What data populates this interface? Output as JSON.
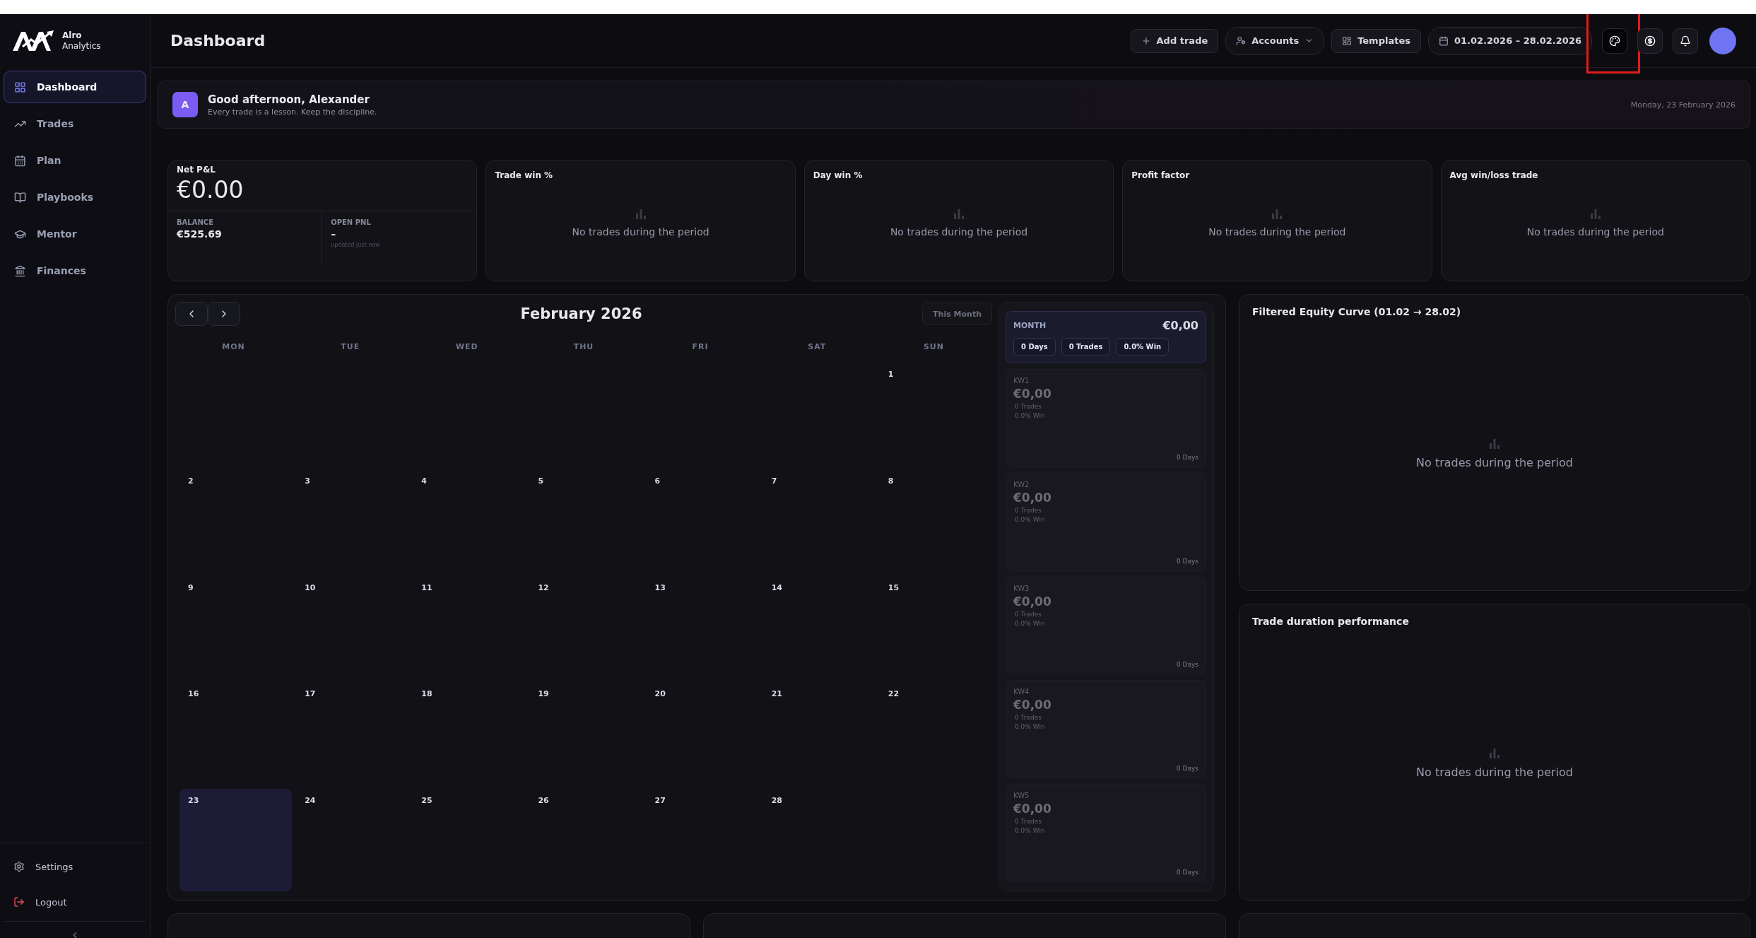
{
  "brand": {
    "name": "Alro",
    "subtitle": "Analytics"
  },
  "sidebar": {
    "items": [
      {
        "label": "Dashboard",
        "kind": "dashboard",
        "selected": true
      },
      {
        "label": "Trades",
        "kind": "trades",
        "selected": false
      },
      {
        "label": "Plan",
        "kind": "plan",
        "selected": false
      },
      {
        "label": "Playbooks",
        "kind": "playbooks",
        "selected": false
      },
      {
        "label": "Mentor",
        "kind": "mentor",
        "selected": false
      },
      {
        "label": "Finances",
        "kind": "finances",
        "selected": false
      }
    ],
    "footer_items": [
      {
        "label": "Settings",
        "kind": "settings"
      },
      {
        "label": "Logout",
        "kind": "logout"
      }
    ]
  },
  "header": {
    "title": "Dashboard",
    "buttons": [
      {
        "label": "Add trade",
        "kind": "add"
      },
      {
        "label": "Accounts",
        "kind": "accounts"
      },
      {
        "label": "Templates",
        "kind": "templates"
      },
      {
        "label": "01.02.2026 – 28.02.2026",
        "kind": "date"
      }
    ],
    "icon_buttons": [
      {
        "kind": "palette",
        "highlighted": true
      },
      {
        "kind": "dollar",
        "highlighted": false
      },
      {
        "kind": "bell",
        "highlighted": false
      }
    ]
  },
  "greeting": {
    "avatar": "A",
    "title": "Good afternoon, Alexander",
    "subtitle": "Every trade is a lesson. Keep the discipline.",
    "date": "Monday, 23 February 2026"
  },
  "kpis": [
    {
      "kind": "pnl",
      "title": "Net P&L",
      "value": "€0.00",
      "balance_label": "BALANCE",
      "balance": "€525.69",
      "open_label": "OPEN PNL",
      "open": "–",
      "updated": "updated just now"
    },
    {
      "kind": "empty",
      "title": "Trade win %",
      "message": "No trades during the period"
    },
    {
      "kind": "empty",
      "title": "Day win %",
      "message": "No trades during the period"
    },
    {
      "kind": "empty",
      "title": "Profit factor",
      "message": "No trades during the period"
    },
    {
      "kind": "empty",
      "title": "Avg win/loss trade",
      "message": "No trades during the period"
    }
  ],
  "calendar": {
    "title": "February 2026",
    "this_month": "This Month",
    "weekdays": [
      "MON",
      "TUE",
      "WED",
      "THU",
      "FRI",
      "SAT",
      "SUN"
    ],
    "weeks": [
      [
        {
          "kind": "blank"
        },
        {
          "kind": "blank"
        },
        {
          "kind": "blank"
        },
        {
          "kind": "blank"
        },
        {
          "kind": "blank"
        },
        {
          "kind": "blank"
        },
        {
          "kind": "day",
          "day": "1",
          "selected": false
        }
      ],
      [
        {
          "kind": "day",
          "day": "2",
          "selected": false
        },
        {
          "kind": "day",
          "day": "3",
          "selected": false
        },
        {
          "kind": "day",
          "day": "4",
          "selected": false
        },
        {
          "kind": "day",
          "day": "5",
          "selected": false
        },
        {
          "kind": "day",
          "day": "6",
          "selected": false
        },
        {
          "kind": "day",
          "day": "7",
          "selected": false
        },
        {
          "kind": "day",
          "day": "8",
          "selected": false
        }
      ],
      [
        {
          "kind": "day",
          "day": "9",
          "selected": false
        },
        {
          "kind": "day",
          "day": "10",
          "selected": false
        },
        {
          "kind": "day",
          "day": "11",
          "selected": false
        },
        {
          "kind": "day",
          "day": "12",
          "selected": false
        },
        {
          "kind": "day",
          "day": "13",
          "selected": false
        },
        {
          "kind": "day",
          "day": "14",
          "selected": false
        },
        {
          "kind": "day",
          "day": "15",
          "selected": false
        }
      ],
      [
        {
          "kind": "day",
          "day": "16",
          "selected": false
        },
        {
          "kind": "day",
          "day": "17",
          "selected": false
        },
        {
          "kind": "day",
          "day": "18",
          "selected": false
        },
        {
          "kind": "day",
          "day": "19",
          "selected": false
        },
        {
          "kind": "day",
          "day": "20",
          "selected": false
        },
        {
          "kind": "day",
          "day": "21",
          "selected": false
        },
        {
          "kind": "day",
          "day": "22",
          "selected": false
        }
      ],
      [
        {
          "kind": "day",
          "day": "23",
          "selected": true
        },
        {
          "kind": "day",
          "day": "24",
          "selected": false
        },
        {
          "kind": "day",
          "day": "25",
          "selected": false
        },
        {
          "kind": "day",
          "day": "26",
          "selected": false
        },
        {
          "kind": "day",
          "day": "27",
          "selected": false
        },
        {
          "kind": "day",
          "day": "28",
          "selected": false
        },
        {
          "kind": "blank"
        }
      ]
    ]
  },
  "week_summary": {
    "month": {
      "label": "MONTH",
      "value": "€0,00",
      "chips": [
        "0 Days",
        "0 Trades",
        "0.0% Win"
      ]
    },
    "weeks": [
      {
        "label": "KW1",
        "value": "€0,00",
        "trades": "0 Trades",
        "win": "0.0% Win",
        "days": "0 Days"
      },
      {
        "label": "KW2",
        "value": "€0,00",
        "trades": "0 Trades",
        "win": "0.0% Win",
        "days": "0 Days"
      },
      {
        "label": "KW3",
        "value": "€0,00",
        "trades": "0 Trades",
        "win": "0.0% Win",
        "days": "0 Days"
      },
      {
        "label": "KW4",
        "value": "€0,00",
        "trades": "0 Trades",
        "win": "0.0% Win",
        "days": "0 Days"
      },
      {
        "label": "KW5",
        "value": "€0,00",
        "trades": "0 Trades",
        "win": "0.0% Win",
        "days": "0 Days"
      }
    ]
  },
  "panels": [
    {
      "title": "Filtered Equity Curve (01.02 → 28.02)",
      "message": "No trades during the period"
    },
    {
      "title": "Trade duration performance",
      "message": "No trades during the period"
    }
  ],
  "bottom_cards": [
    {
      "kind": "card"
    },
    {
      "kind": "card"
    },
    {
      "kind": "card"
    }
  ]
}
